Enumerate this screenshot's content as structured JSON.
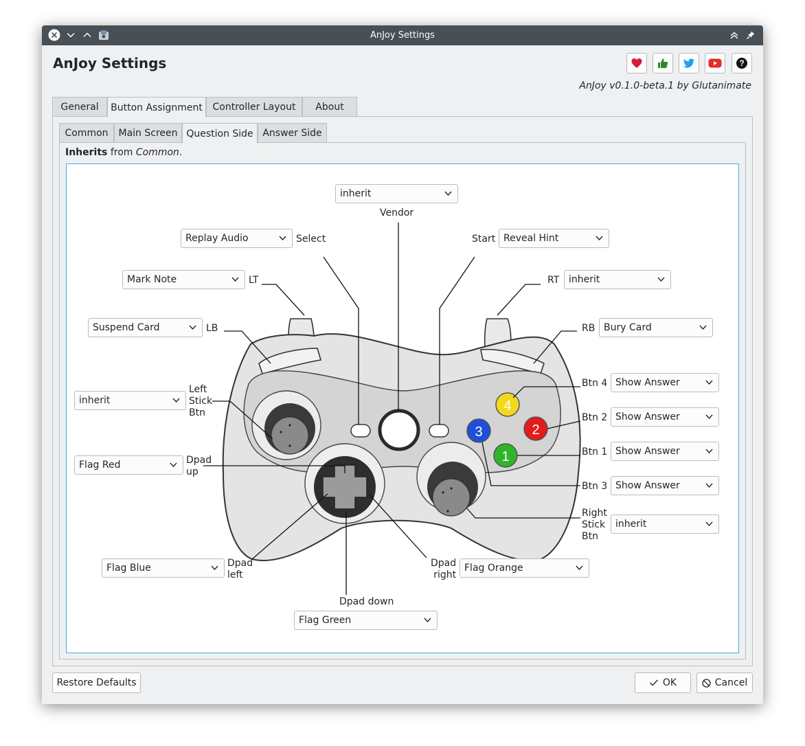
{
  "window": {
    "title": "AnJoy Settings"
  },
  "header": {
    "title": "AnJoy Settings",
    "version": "AnJoy v0.1.0-beta.1 by Glutanimate",
    "icons": [
      "heart-icon",
      "thumbs-up-icon",
      "twitter-icon",
      "youtube-icon",
      "help-icon"
    ]
  },
  "tabs": [
    "General",
    "Button Assignment",
    "Controller Layout",
    "About"
  ],
  "active_tab": "Button Assignment",
  "subtabs": [
    "Common",
    "Main Screen",
    "Question Side",
    "Answer Side"
  ],
  "active_subtab": "Question Side",
  "inherits": {
    "bold": "Inherits",
    "mid": " from ",
    "italic": "Common",
    "end": "."
  },
  "labels": {
    "vendor": "Vendor",
    "select": "Select",
    "start": "Start",
    "lt": "LT",
    "rt": "RT",
    "lb": "LB",
    "rb": "RB",
    "left_stick_1": "Left",
    "left_stick_2": "Stick",
    "left_stick_3": "Btn",
    "dpad_up_1": "Dpad",
    "dpad_up_2": "up",
    "dpad_left_1": "Dpad",
    "dpad_left_2": "left",
    "dpad_right_1": "Dpad",
    "dpad_right_2": "right",
    "dpad_down": "Dpad down",
    "btn4": "Btn 4",
    "btn2": "Btn 2",
    "btn1": "Btn 1",
    "btn3": "Btn 3",
    "right_stick_1": "Right",
    "right_stick_2": "Stick",
    "right_stick_3": "Btn"
  },
  "assignments": {
    "vendor": "inherit",
    "select": "Replay Audio",
    "start": "Reveal Hint",
    "lt": "Mark Note",
    "rt": "inherit",
    "lb": "Suspend Card",
    "rb": "Bury Card",
    "left_stick": "inherit",
    "dpad_up": "Flag Red",
    "dpad_left": "Flag Blue",
    "dpad_right": "Flag Orange",
    "dpad_down": "Flag Green",
    "btn4": "Show Answer",
    "btn2": "Show Answer",
    "btn1": "Show Answer",
    "btn3": "Show Answer",
    "right_stick": "inherit"
  },
  "face_buttons": {
    "b1": "1",
    "b2": "2",
    "b3": "3",
    "b4": "4"
  },
  "face_colors": {
    "b1": "#2fb52a",
    "b2": "#e21b1b",
    "b3": "#1f4fd8",
    "b4": "#f3d91c"
  },
  "footer": {
    "restore": "Restore Defaults",
    "ok": "OK",
    "cancel": "Cancel"
  },
  "colors": {
    "titlebar": "#475057",
    "accent": "#3daee9",
    "window_bg": "#eff0f1"
  }
}
